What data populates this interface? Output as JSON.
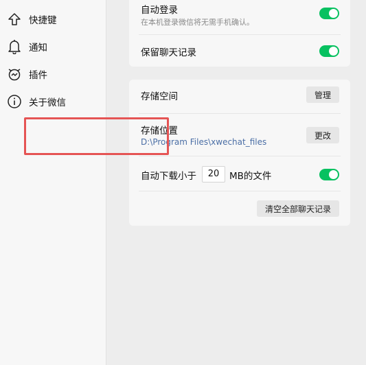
{
  "sidebar": {
    "items": [
      {
        "label": "快捷键",
        "icon": "arrow-up-icon"
      },
      {
        "label": "通知",
        "icon": "bell-icon"
      },
      {
        "label": "插件",
        "icon": "plugin-icon"
      },
      {
        "label": "关于微信",
        "icon": "info-icon"
      }
    ]
  },
  "login": {
    "auto_login_title": "自动登录",
    "auto_login_desc": "在本机登录微信将无需手机确认。",
    "auto_login_on": true,
    "keep_history_title": "保留聊天记录",
    "keep_history_on": true
  },
  "storage": {
    "space_title": "存储空间",
    "manage_label": "管理",
    "location_title": "存储位置",
    "location_path": "D:\\Program Files\\xwechat_files",
    "change_label": "更改",
    "auto_download_prefix": "自动下载小于",
    "auto_download_size": "20",
    "auto_download_suffix": "MB的文件",
    "auto_download_on": true,
    "clear_history_label": "清空全部聊天记录"
  },
  "colors": {
    "accent_green": "#07c160",
    "highlight_red": "#e55454",
    "link_blue": "#4a6ea5"
  }
}
